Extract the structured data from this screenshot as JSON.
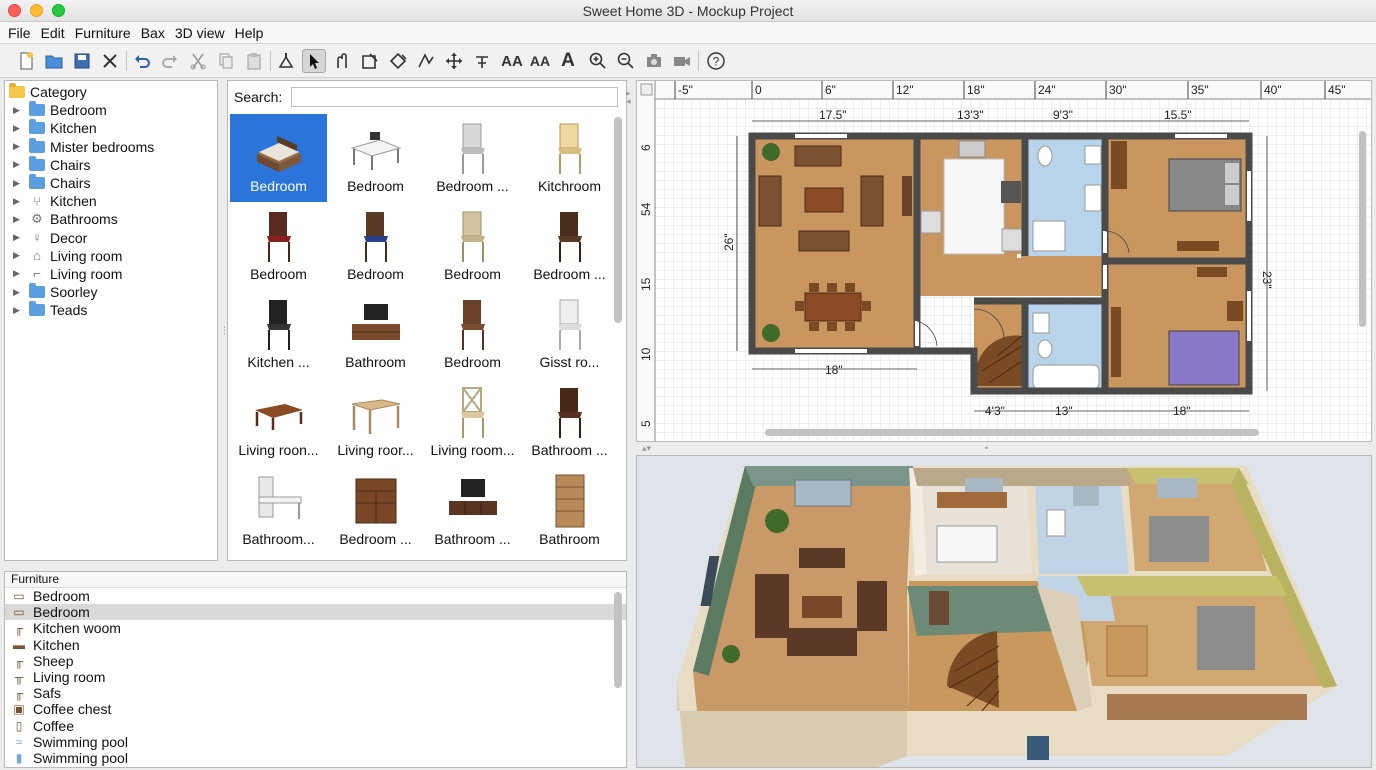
{
  "window": {
    "title": "Sweet Home 3D - Mockup Project"
  },
  "menu": [
    "File",
    "Edit",
    "Furniture",
    "Bax",
    "3D view",
    "Help"
  ],
  "toolbar": {
    "text_tools": [
      "AA",
      "AA",
      "A"
    ],
    "help": "?"
  },
  "category_tree": {
    "root": "Category",
    "items": [
      "Bedroom",
      "Kitchen",
      "Mister bedrooms",
      "Chairs",
      "Chairs",
      "Kitchen",
      "Bathrooms",
      "Decor",
      "Living room",
      "Living room",
      "Soorley",
      "Teads"
    ]
  },
  "catalog": {
    "search_label": "Search:",
    "search_value": "",
    "items": [
      "Bedroom",
      "Bedroom",
      "Bedroom ...",
      "Kitchroom",
      "Bedroom",
      "Bedroom",
      "Bedroom",
      "Bedroom ...",
      "Kitchen ...",
      "Bathroom",
      "Bedroom",
      "Gisst ro...",
      "Living roon...",
      "Living roor...",
      "Living room...",
      "Bathroom ...",
      "Bathroom...",
      "Bedroom ...",
      "Bathroom ...",
      "Bathroom"
    ]
  },
  "furniture_list": {
    "header": "Furniture",
    "items": [
      "Bedroom",
      "Bedroom",
      "Kitchen woom",
      "Kitchen",
      "Sheep",
      "Living room",
      "Safs",
      "Coffee chest",
      "Coffee",
      "Swimming pool",
      "Swimming pool"
    ],
    "selected_index": 1
  },
  "plan": {
    "ruler_top": [
      "-5\"",
      "0",
      "6\"",
      "12\"",
      "18\"",
      "24\"",
      "30\"",
      "35\"",
      "40\"",
      "45\""
    ],
    "ruler_left": [
      "6",
      "54",
      "15",
      "10",
      "5"
    ],
    "dims_top": [
      "17.5\"",
      "13'3\"",
      "9'3\"",
      "15.5\""
    ],
    "dims_bottom": [
      "18\"",
      "4'3\"",
      "13\"",
      "18\""
    ],
    "dim_left": "26\"",
    "dim_right": "23\""
  },
  "colors": {
    "selection": "#2b74d9",
    "floor_wood": "#c9965f",
    "floor_tile": "#b8d4ea",
    "wall": "#4a4a4a"
  }
}
